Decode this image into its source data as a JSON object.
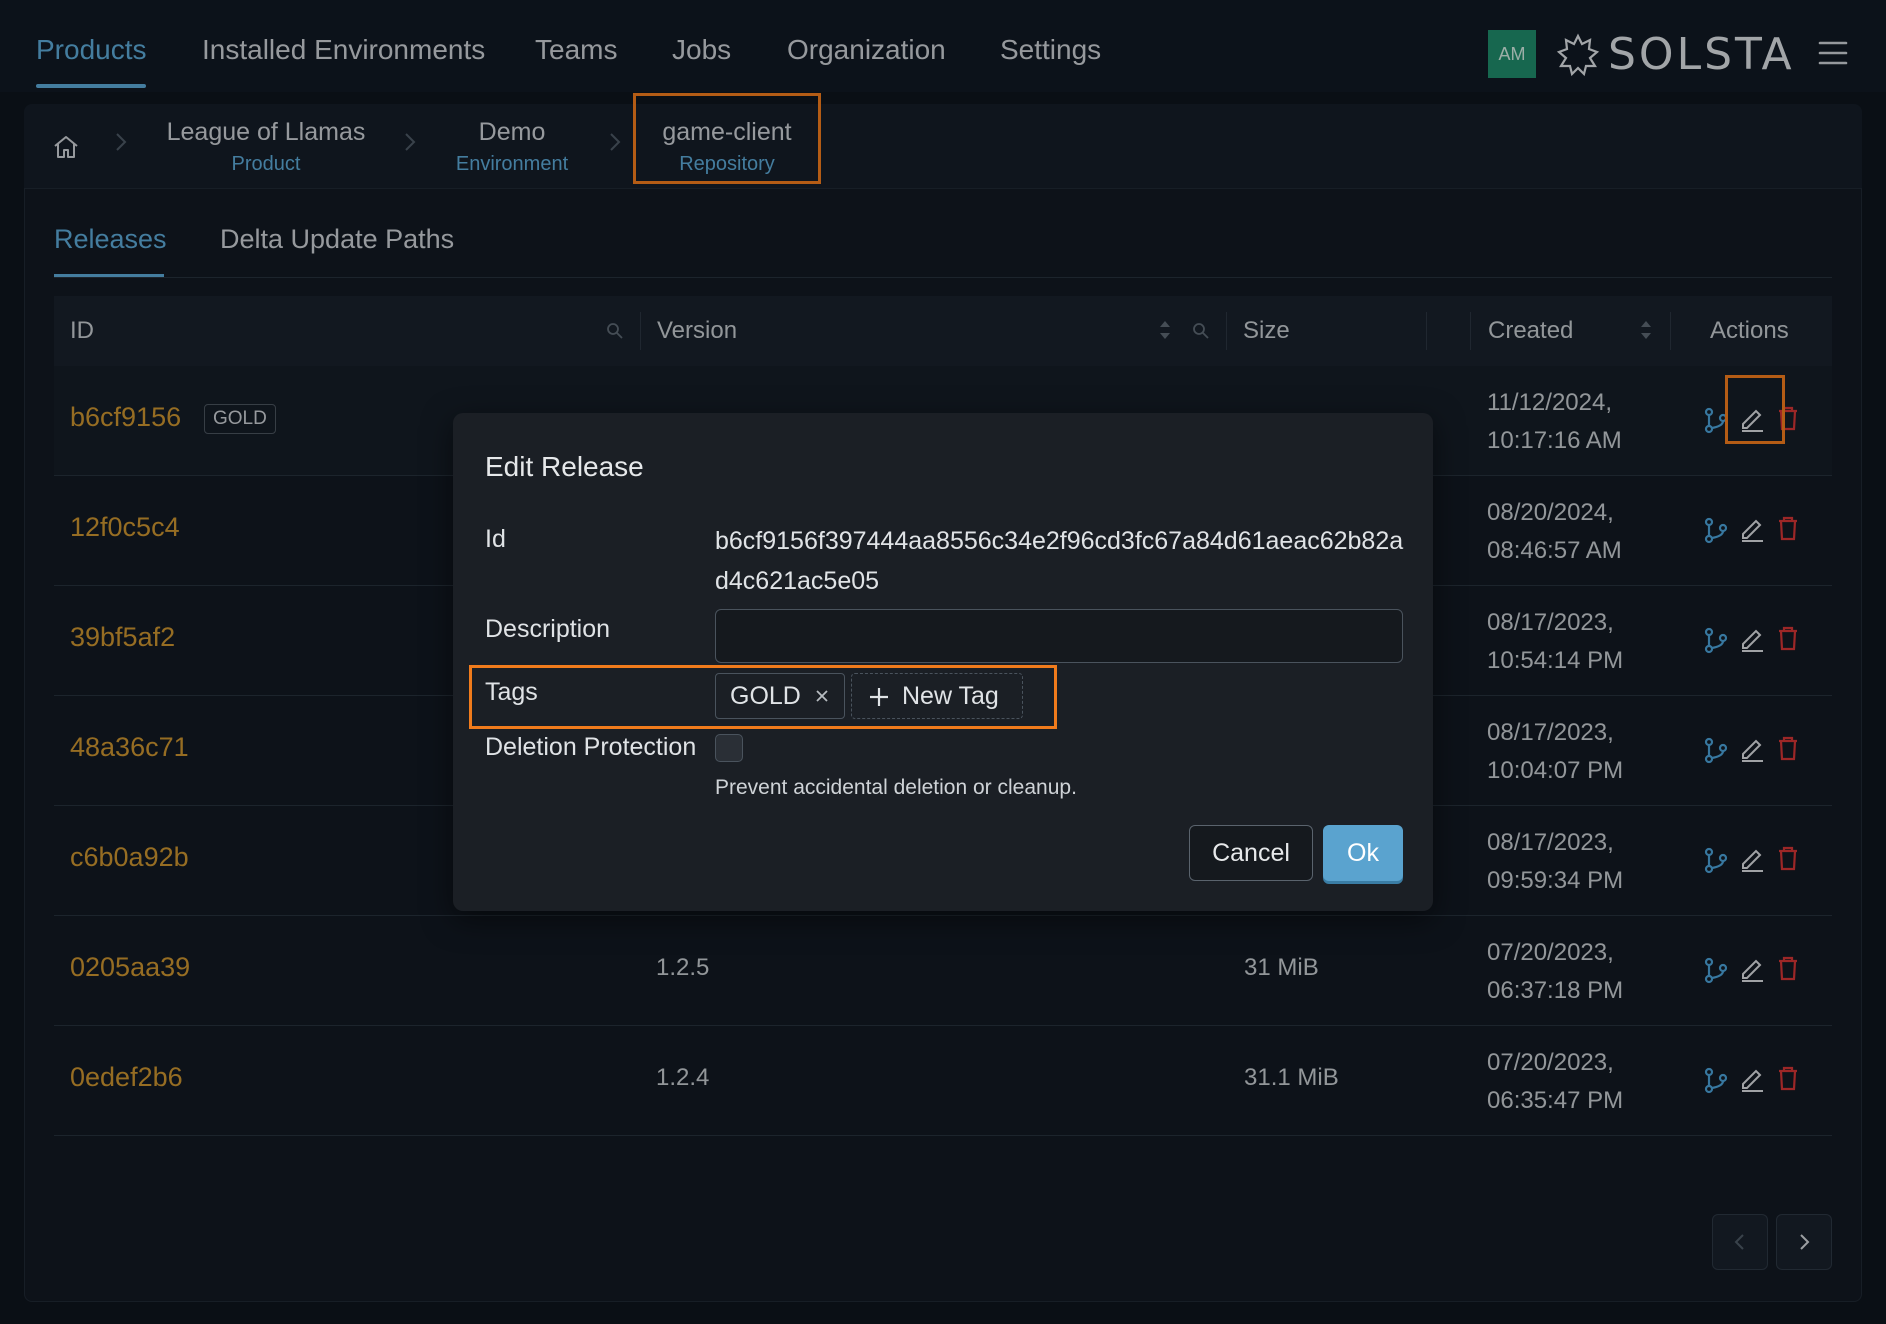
{
  "nav": {
    "tabs": [
      "Products",
      "Installed Environments",
      "Teams",
      "Jobs",
      "Organization",
      "Settings"
    ],
    "avatar": "AM",
    "logo": "SOLSTA"
  },
  "breadcrumb": [
    {
      "title": "League of Llamas",
      "sub": "Product"
    },
    {
      "title": "Demo",
      "sub": "Environment"
    },
    {
      "title": "game-client",
      "sub": "Repository"
    }
  ],
  "tabs": [
    "Releases",
    "Delta Update Paths"
  ],
  "table": {
    "headers": {
      "id": "ID",
      "version": "Version",
      "size": "Size",
      "created": "Created",
      "actions": "Actions"
    },
    "rows": [
      {
        "id": "b6cf9156",
        "badge": "GOLD",
        "version": "",
        "size": "",
        "date": "11/12/2024,",
        "time": "10:17:16 AM"
      },
      {
        "id": "12f0c5c4",
        "badge": "",
        "version": "",
        "size": "",
        "date": "08/20/2024,",
        "time": "08:46:57 AM"
      },
      {
        "id": "39bf5af2",
        "badge": "",
        "version": "",
        "size": "",
        "date": "08/17/2023,",
        "time": "10:54:14 PM"
      },
      {
        "id": "48a36c71",
        "badge": "",
        "version": "",
        "size": "",
        "date": "08/17/2023,",
        "time": "10:04:07 PM"
      },
      {
        "id": "c6b0a92b",
        "badge": "",
        "version": "",
        "size": "",
        "date": "08/17/2023,",
        "time": "09:59:34 PM"
      },
      {
        "id": "0205aa39",
        "badge": "",
        "version": "1.2.5",
        "size": "31 MiB",
        "date": "07/20/2023,",
        "time": "06:37:18 PM"
      },
      {
        "id": "0edef2b6",
        "badge": "",
        "version": "1.2.4",
        "size": "31.1 MiB",
        "date": "07/20/2023,",
        "time": "06:35:47 PM"
      }
    ]
  },
  "modal": {
    "title": "Edit Release",
    "id_label": "Id",
    "id_value": "b6cf9156f397444aa8556c34e2f96cd3fc67a84d61aeac62b82ad4c621ac5e05",
    "description_label": "Description",
    "description_value": "",
    "tags_label": "Tags",
    "tag": "GOLD",
    "new_tag_label": "New Tag",
    "deletion_label": "Deletion Protection",
    "deletion_help": "Prevent accidental deletion or cleanup.",
    "cancel_label": "Cancel",
    "ok_label": "Ok"
  },
  "colors": {
    "accent": "#5ba7d4",
    "id_text": "#c8922f",
    "highlight": "#f07b1c",
    "danger": "#d13434"
  }
}
